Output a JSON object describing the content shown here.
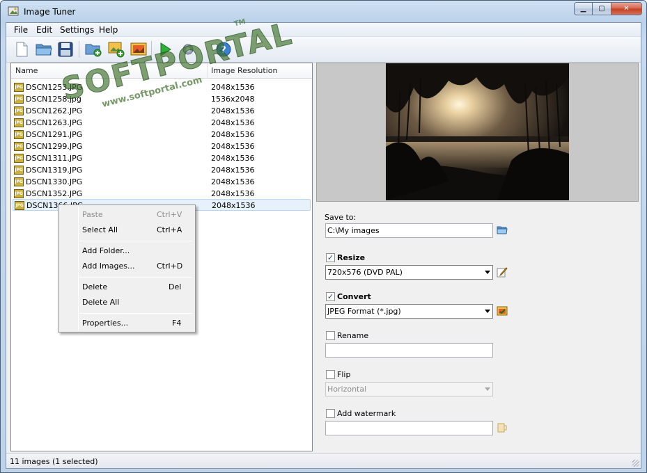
{
  "window": {
    "title": "Image Tuner"
  },
  "window_buttons": {
    "minimize": "▁",
    "maximize": "▢",
    "close": "✕"
  },
  "menu": [
    "File",
    "Edit",
    "Settings",
    "Help"
  ],
  "toolbar": [
    "new-file-icon",
    "open-folder-icon",
    "save-icon",
    "add-folder-icon",
    "add-images-icon",
    "image-icon",
    "run-icon",
    "settings-icon",
    "help-icon"
  ],
  "list": {
    "headers": {
      "name": "Name",
      "resolution": "Image Resolution"
    },
    "icon_text": "JPG",
    "rows": [
      {
        "name": "DSCN1253.JPG",
        "res": "2048x1536"
      },
      {
        "name": "DSCN1258.jpg",
        "res": "1536x2048"
      },
      {
        "name": "DSCN1262.JPG",
        "res": "2048x1536"
      },
      {
        "name": "DSCN1263.JPG",
        "res": "2048x1536"
      },
      {
        "name": "DSCN1291.JPG",
        "res": "2048x1536"
      },
      {
        "name": "DSCN1299.JPG",
        "res": "2048x1536"
      },
      {
        "name": "DSCN1311.JPG",
        "res": "2048x1536"
      },
      {
        "name": "DSCN1319.JPG",
        "res": "2048x1536"
      },
      {
        "name": "DSCN1330.JPG",
        "res": "2048x1536"
      },
      {
        "name": "DSCN1352.JPG",
        "res": "2048x1536"
      },
      {
        "name": "DSCN1366.JPG",
        "res": "2048x1536"
      }
    ]
  },
  "context_menu": {
    "paste": "Paste",
    "paste_key": "Ctrl+V",
    "select_all": "Select All",
    "select_all_key": "Ctrl+A",
    "add_folder": "Add Folder...",
    "add_images": "Add Images...",
    "add_images_key": "Ctrl+D",
    "delete": "Delete",
    "delete_key": "Del",
    "delete_all": "Delete All",
    "properties": "Properties...",
    "properties_key": "F4"
  },
  "settings": {
    "save_to_label": "Save to:",
    "save_to_value": "C:\\My images",
    "resize_label": "Resize",
    "resize_checked": true,
    "resize_value": "720x576 (DVD PAL)",
    "convert_label": "Convert",
    "convert_checked": true,
    "convert_value": "JPEG Format (*.jpg)",
    "rename_label": "Rename",
    "rename_checked": false,
    "rename_value": "",
    "flip_label": "Flip",
    "flip_checked": false,
    "flip_value": "Horizontal",
    "watermark_label": "Add watermark",
    "watermark_checked": false,
    "watermark_value": ""
  },
  "check_mark": "✓",
  "status": {
    "text": "11 images (1 selected)"
  },
  "stamp": {
    "main": "SOFTPORTAL",
    "url": "www.softportal.com",
    "tm": "TM"
  },
  "colors": {
    "selection": "#e6f1fb",
    "stamp": "#3c6e28"
  }
}
